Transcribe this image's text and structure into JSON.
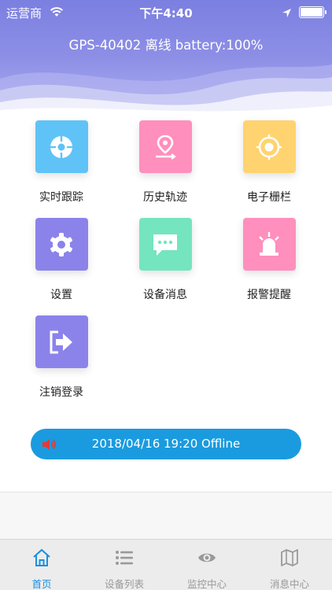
{
  "status_bar": {
    "carrier": "运营商",
    "time": "下午4:40"
  },
  "header": {
    "title": "GPS-40402 离线 battery:100%"
  },
  "menu": [
    {
      "label": "实时跟踪",
      "icon": "crosshair-icon",
      "color": "#5fc3f7"
    },
    {
      "label": "历史轨迹",
      "icon": "route-pin-icon",
      "color": "#ff8fbd"
    },
    {
      "label": "电子栅栏",
      "icon": "geofence-target-icon",
      "color": "#ffd36f"
    },
    {
      "label": "设置",
      "icon": "gear-icon",
      "color": "#8b83ea"
    },
    {
      "label": "设备消息",
      "icon": "chat-bubble-icon",
      "color": "#74e5bf"
    },
    {
      "label": "报警提醒",
      "icon": "alarm-siren-icon",
      "color": "#ff8fbd"
    },
    {
      "label": "注销登录",
      "icon": "logout-icon",
      "color": "#8b83ea"
    }
  ],
  "alert": {
    "text": "2018/04/16 19:20 Offline",
    "icon": "speaker-icon",
    "color": "#1a9bdf"
  },
  "tabs": [
    {
      "label": "首页",
      "icon": "home-icon",
      "active": true
    },
    {
      "label": "设备列表",
      "icon": "list-icon",
      "active": false
    },
    {
      "label": "监控中心",
      "icon": "eye-icon",
      "active": false
    },
    {
      "label": "消息中心",
      "icon": "map-icon",
      "active": false
    }
  ]
}
